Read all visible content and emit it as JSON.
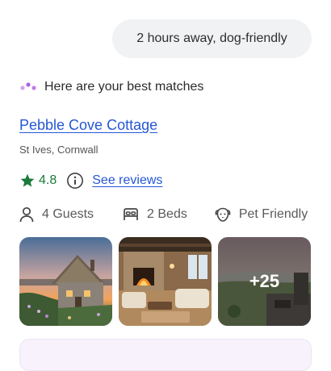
{
  "chat": {
    "user_message": "2 hours away, dog-friendly",
    "assistant_intro": "Here are your best matches"
  },
  "listing": {
    "title": "Pebble Cove Cottage",
    "location": "St Ives, Cornwall",
    "rating": "4.8",
    "reviews_link": "See reviews",
    "amenities": {
      "guests": "4 Guests",
      "beds": "2 Beds",
      "pets": "Pet Friendly"
    },
    "photos": [
      {
        "name": "cottage-exterior-photo"
      },
      {
        "name": "living-room-photo"
      },
      {
        "name": "coastal-terrace-photo"
      }
    ],
    "more_photos_label": "+25"
  },
  "colors": {
    "link": "#2557d6",
    "rating_green": "#1a7a3a",
    "bubble_bg": "#f1f2f4",
    "dots_purple": "#b15fe0"
  }
}
